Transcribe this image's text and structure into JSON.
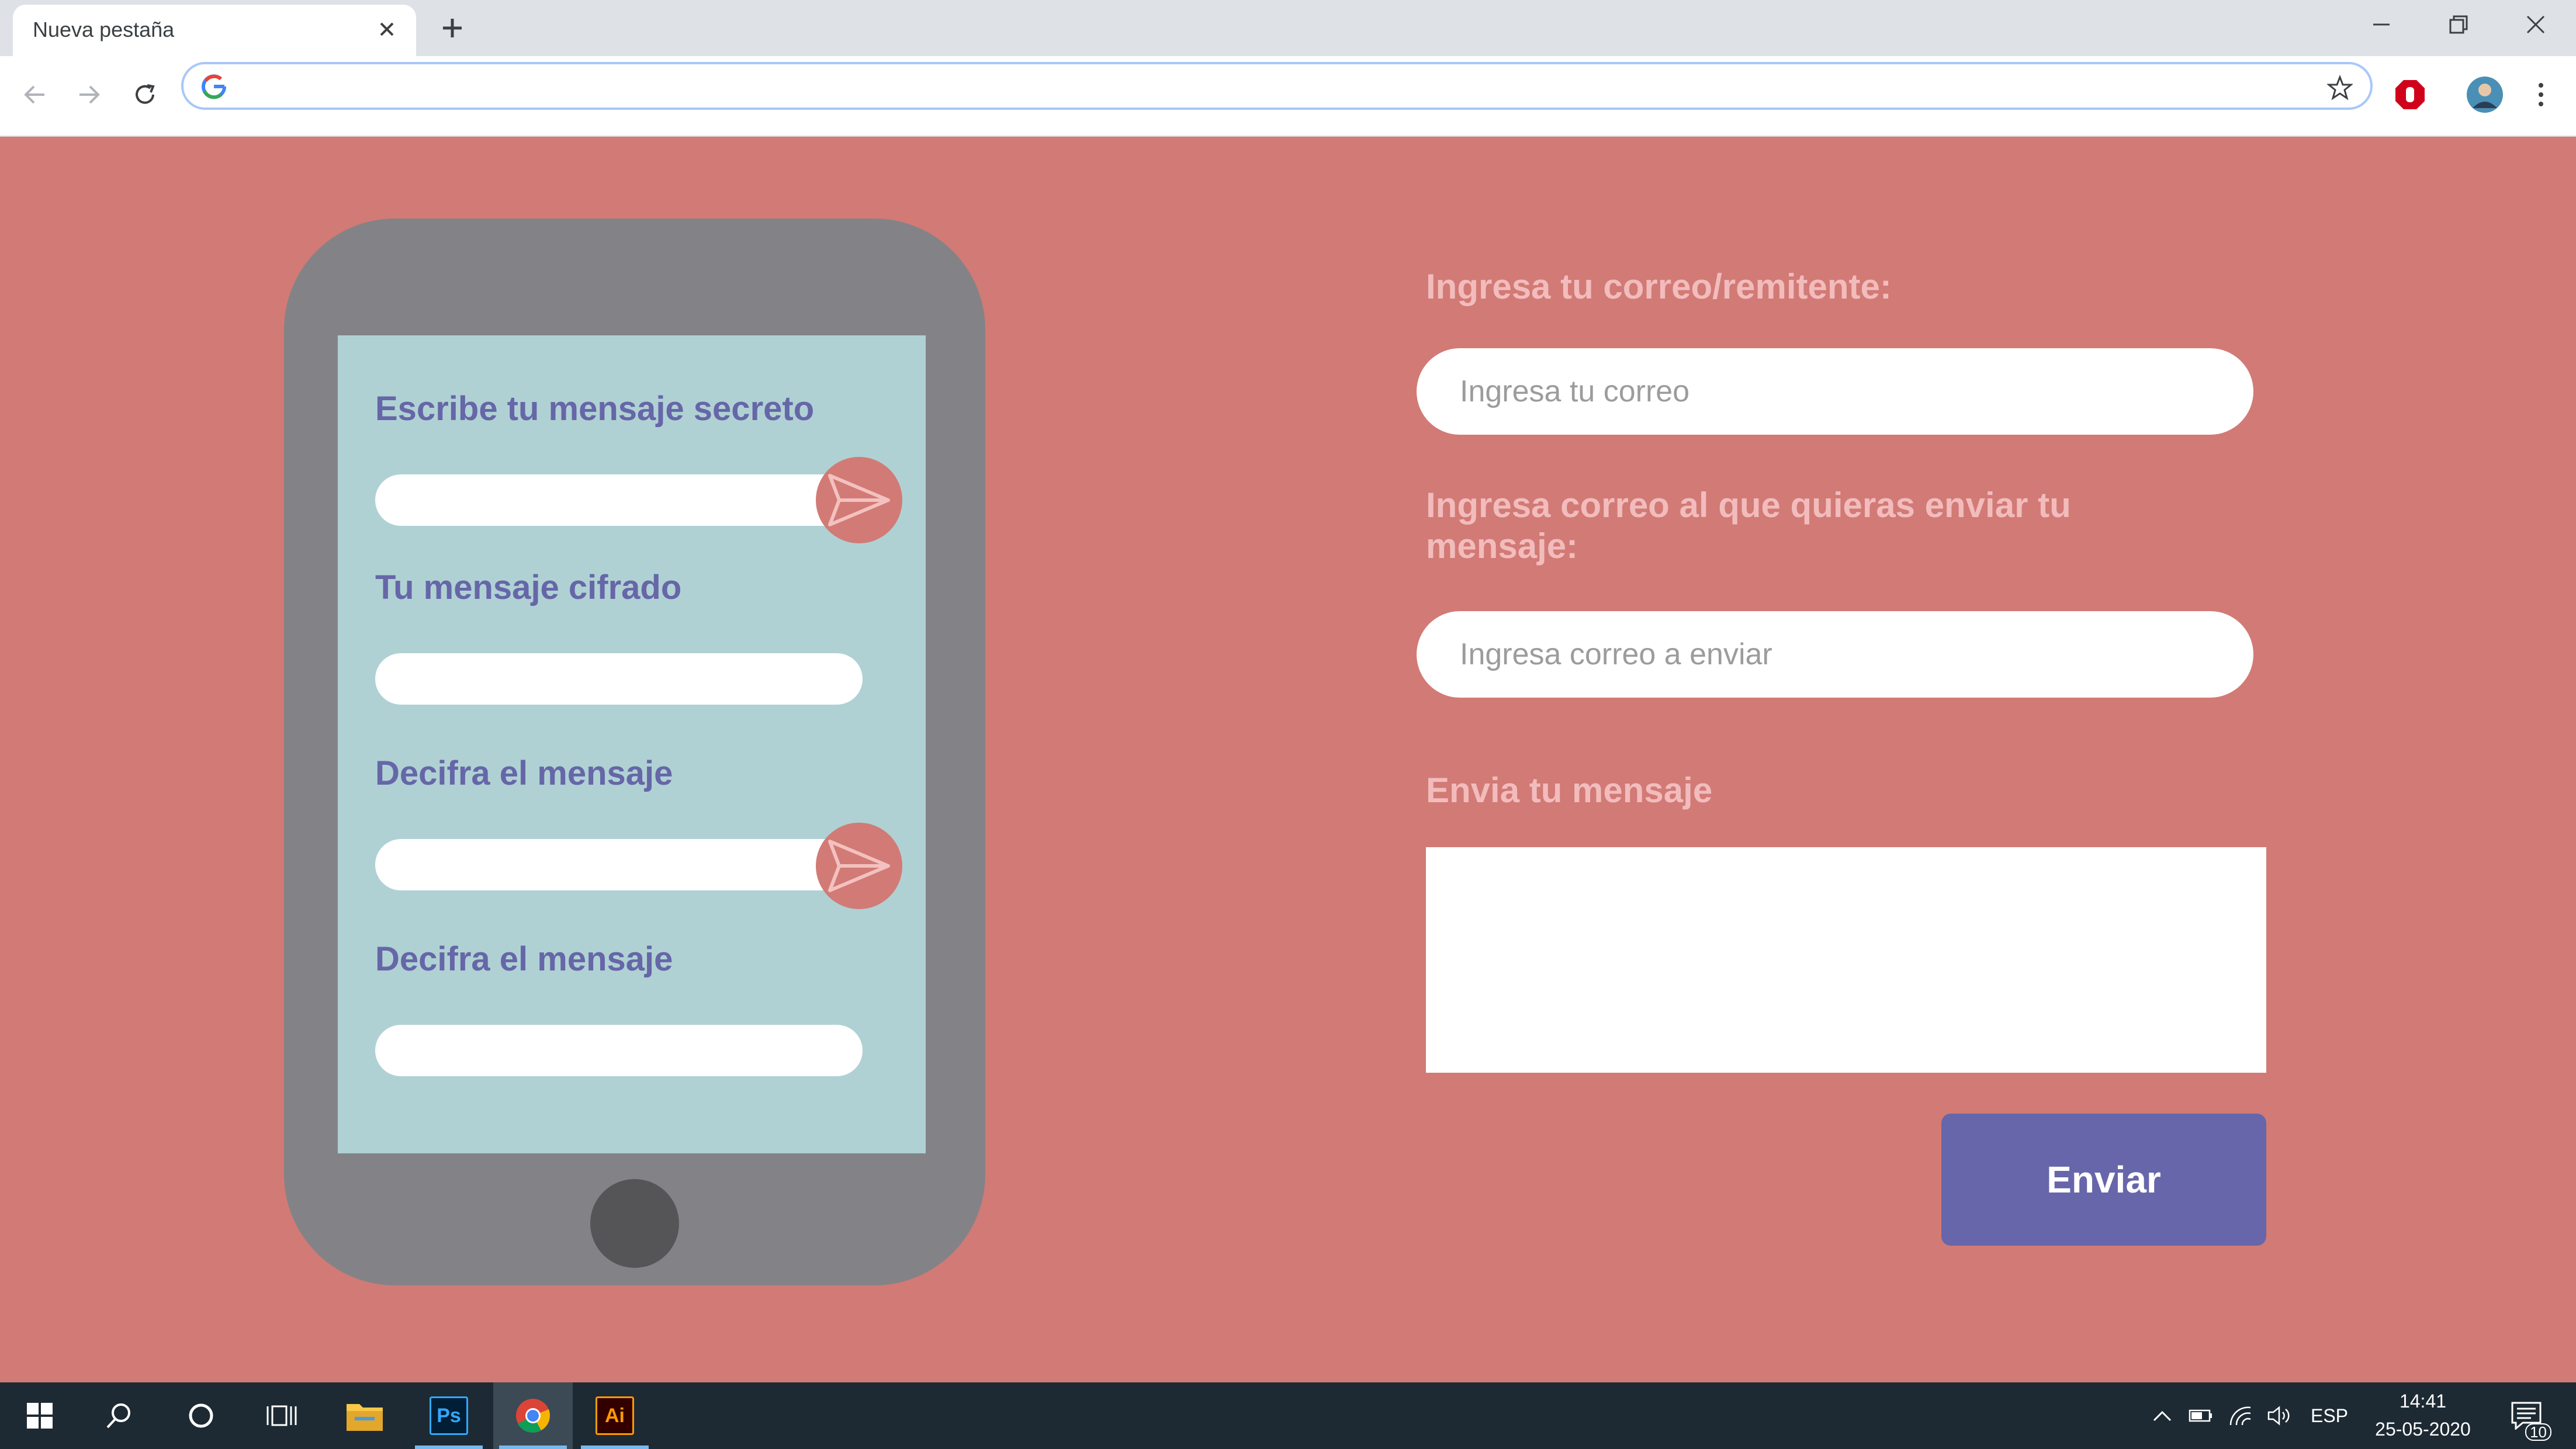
{
  "browser": {
    "tab_title": "Nueva pestaña",
    "address_value": ""
  },
  "phone": {
    "encrypt_label": "Escribe tu mensaje secreto",
    "cipher_label": "Tu mensaje cifrado",
    "decrypt_label": "Decifra el mensaje",
    "decrypt_result_label": "Decifra el mensaje"
  },
  "form": {
    "sender_label": "Ingresa tu correo/remitente:",
    "sender_placeholder": "Ingresa tu correo",
    "recipient_label": "Ingresa correo al que quieras enviar tu mensaje:",
    "recipient_placeholder": "Ingresa correo a enviar",
    "message_label": "Envia tu mensaje",
    "submit_label": "Enviar"
  },
  "taskbar": {
    "language": "ESP",
    "time": "14:41",
    "date": "25-05-2020",
    "notification_count": "10",
    "photoshop_label": "Ps",
    "illustrator_label": "Ai"
  },
  "colors": {
    "page_bg": "#d27a75",
    "phone_body": "#838387",
    "phone_screen": "#afd1d3",
    "accent_purple": "#6766aa",
    "label_pink": "#f2bcbd"
  }
}
